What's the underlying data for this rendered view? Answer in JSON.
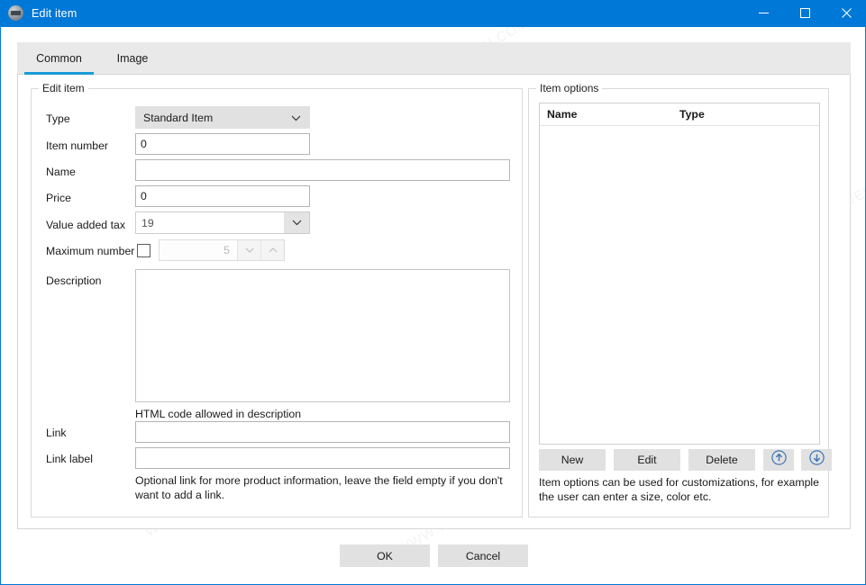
{
  "window": {
    "title": "Edit item",
    "icon": "app-icon",
    "controls": {
      "minimize": "minimize-icon",
      "maximize": "maximize-icon",
      "close": "close-icon"
    }
  },
  "tabs": [
    {
      "label": "Common",
      "active": true
    },
    {
      "label": "Image",
      "active": false
    }
  ],
  "edit_item": {
    "legend": "Edit item",
    "type": {
      "label": "Type",
      "value": "Standard Item"
    },
    "item_number": {
      "label": "Item number",
      "value": "0"
    },
    "name": {
      "label": "Name",
      "value": ""
    },
    "price": {
      "label": "Price",
      "value": "0"
    },
    "vat": {
      "label": "Value added tax",
      "value": "19"
    },
    "maximum_number": {
      "label": "Maximum number",
      "checked": false,
      "value": "5"
    },
    "description": {
      "label": "Description",
      "value": ""
    },
    "description_hint": "HTML code allowed in description",
    "link": {
      "label": "Link",
      "value": ""
    },
    "link_label": {
      "label": "Link label",
      "value": ""
    },
    "link_hint": "Optional link for more product information, leave the field empty if you don't want to add a link."
  },
  "item_options": {
    "legend": "Item options",
    "columns": [
      "Name",
      "Type"
    ],
    "rows": [],
    "buttons": {
      "new": "New",
      "edit": "Edit",
      "delete": "Delete",
      "move_up": "arrow-up-circle-icon",
      "move_down": "arrow-down-circle-icon"
    },
    "hint": "Item options can be used for customizations, for example the user can enter a size, color etc."
  },
  "footer": {
    "ok": "OK",
    "cancel": "Cancel"
  },
  "watermark": "WWW.WEIDOWN.COM",
  "colors": {
    "titlebar": "#0078d7",
    "tab_accent": "#1a9bd7",
    "button_face": "#e1e1e1",
    "arrow_icon": "#3b74b5"
  }
}
